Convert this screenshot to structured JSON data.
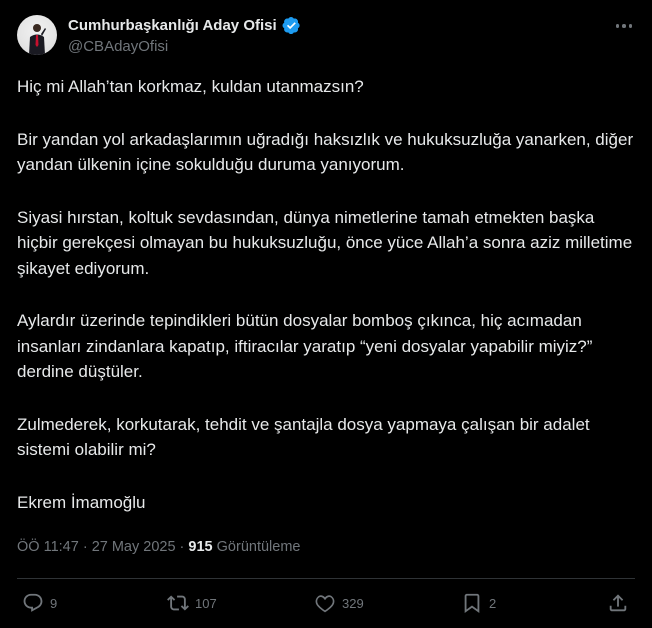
{
  "author": {
    "name": "Cumhurbaşkanlığı Aday Ofisi",
    "handle": "@CBAdayOfisi",
    "verified": true,
    "verified_color": "#1d9bf0"
  },
  "body": {
    "paragraphs": [
      "Hiç mi Allah’tan korkmaz, kuldan utanmazsın?",
      "Bir yandan yol arkadaşlarımın uğradığı haksızlık ve hukuksuzluğa yanarken, diğer yandan ülkenin içine sokulduğu duruma yanıyorum.",
      "Siyasi hırstan, koltuk sevdasından, dünya nimetlerine tamah etmekten başka hiçbir gerekçesi olmayan bu hukuksuzluğu, önce yüce Allah’a sonra aziz milletime şikayet ediyorum.",
      "Aylardır üzerinde tepindikleri bütün dosyalar bomboş çıkınca, hiç acımadan insanları zindanlara kapatıp, iftiracılar yaratıp “yeni dosyalar yapabilir miyiz?” derdine düştüler.",
      "Zulmederek, korkutarak, tehdit ve şantajla dosya yapmaya çalışan bir adalet sistemi olabilir mi?",
      "Ekrem İmamoğlu"
    ]
  },
  "meta": {
    "time": "ÖÖ 11:47",
    "separator": " · ",
    "date": "27 May 2025",
    "views_count": "915",
    "views_label": " Görüntüleme"
  },
  "actions": {
    "replies": "9",
    "reposts": "107",
    "likes": "329",
    "bookmarks": "2"
  },
  "icons": [
    "verified-badge-icon",
    "more-icon",
    "reply-icon",
    "repost-icon",
    "like-icon",
    "bookmark-icon",
    "share-icon"
  ],
  "colors": {
    "background": "#000000",
    "text": "#e7e9ea",
    "muted": "#71767b",
    "accent": "#1d9bf0",
    "divider": "#2f3336"
  }
}
